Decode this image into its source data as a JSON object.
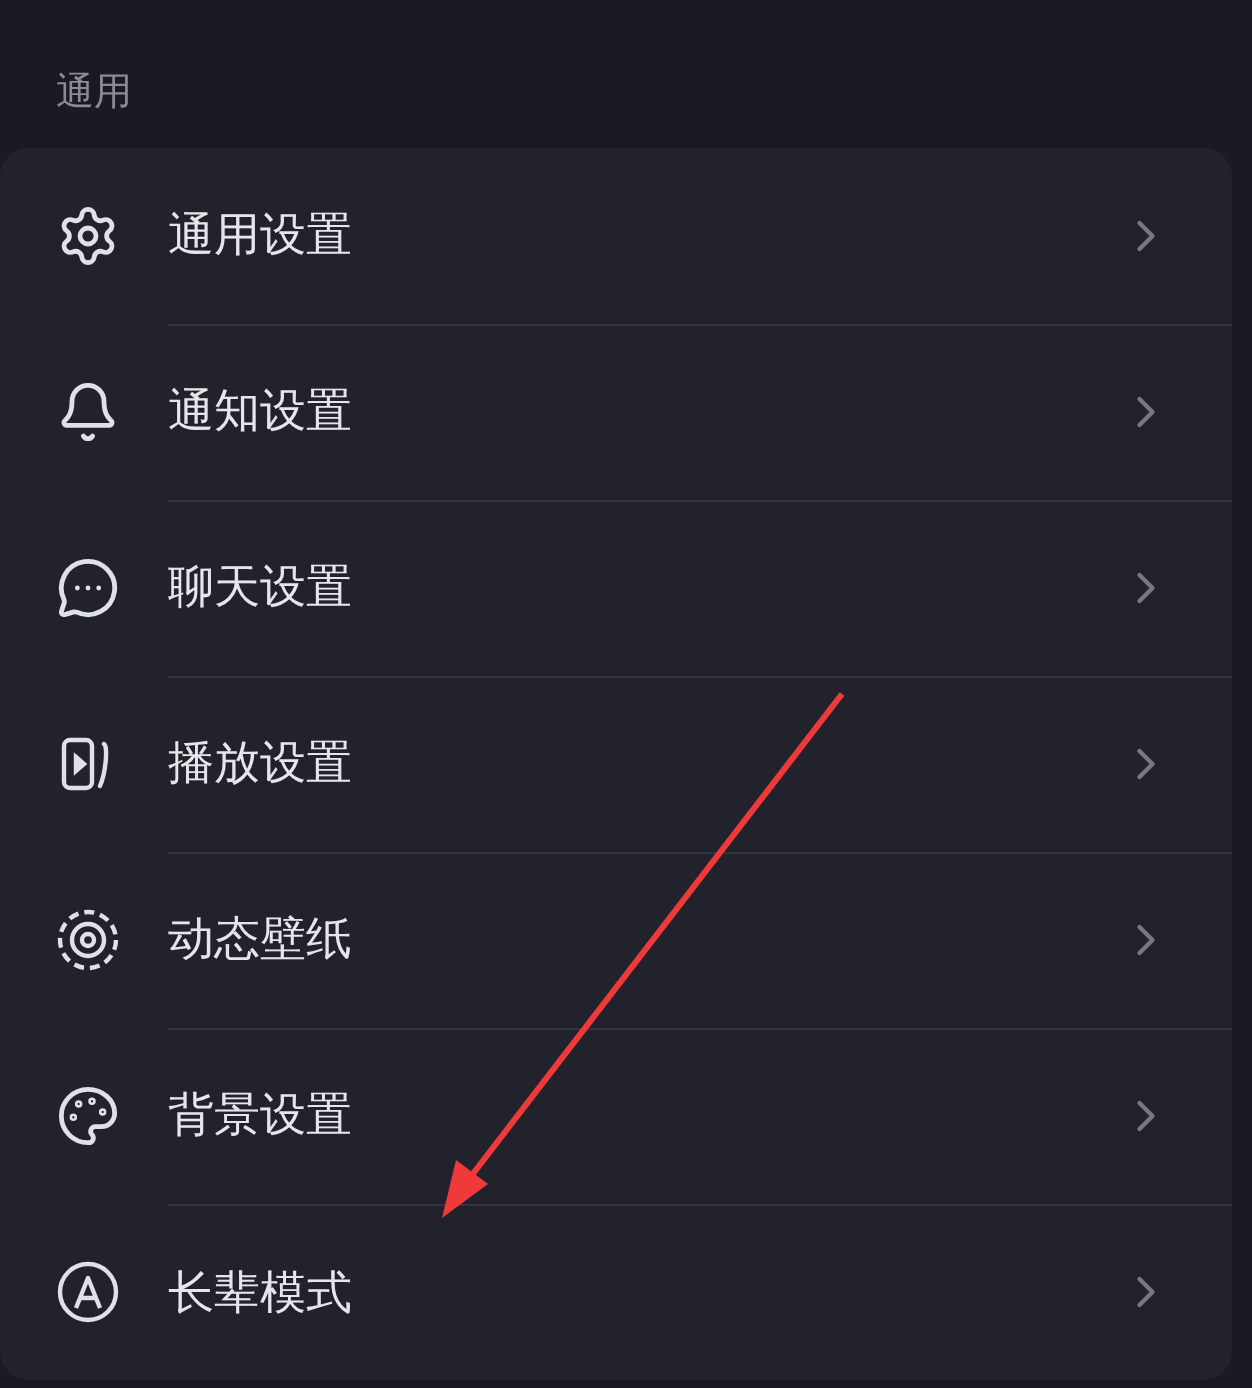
{
  "section": {
    "title": "通用"
  },
  "items": [
    {
      "label": "通用设置",
      "kind": "gear"
    },
    {
      "label": "通知设置",
      "kind": "bell"
    },
    {
      "label": "聊天设置",
      "kind": "chat"
    },
    {
      "label": "播放设置",
      "kind": "play"
    },
    {
      "label": "动态壁纸",
      "kind": "wallpaper"
    },
    {
      "label": "背景设置",
      "kind": "palette"
    },
    {
      "label": "长辈模式",
      "kind": "elder"
    }
  ]
}
